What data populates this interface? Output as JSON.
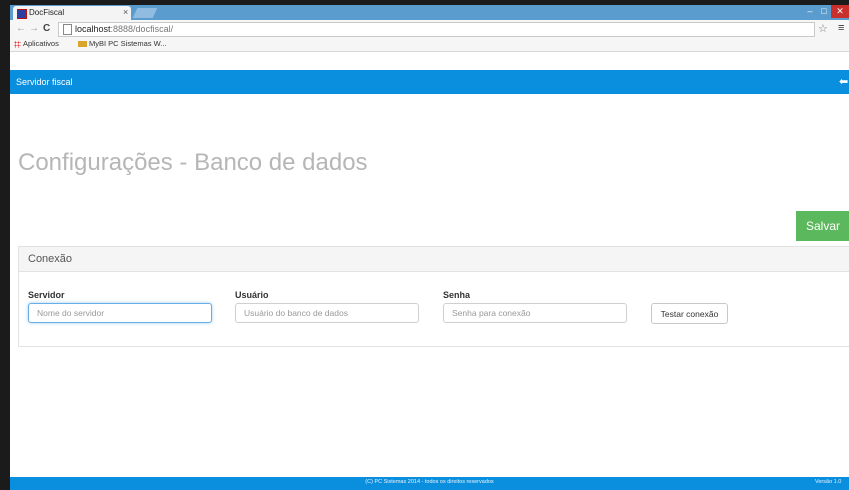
{
  "browser": {
    "tab_title": "DocFiscal",
    "tab_close": "×",
    "window_min": "–",
    "window_max": "□",
    "window_close": "✕",
    "back": "←",
    "forward": "→",
    "reload": "C",
    "url_host": "localhost",
    "url_rest": ":8888/docfiscal/",
    "bookmark_star": "☆",
    "menu": "≡",
    "bookmarks": [
      {
        "label": "Aplicativos",
        "icon": "apps-grid-icon"
      },
      {
        "label": "MyBI PC Sistemas W...",
        "icon": "folder-icon"
      }
    ]
  },
  "navbar": {
    "brand": "Servidor fiscal",
    "signout_icon": "sign-out-arrow-icon",
    "signout_glyph": "⬅"
  },
  "page": {
    "title": "Configurações - Banco de dados",
    "save_label": "Salvar"
  },
  "panel": {
    "title": "Conexão",
    "fields": {
      "servidor": {
        "label": "Servidor",
        "placeholder": "Nome do servidor",
        "value": ""
      },
      "usuario": {
        "label": "Usuário",
        "placeholder": "Usuário do banco de dados",
        "value": ""
      },
      "senha": {
        "label": "Senha",
        "placeholder": "Senha para conexão",
        "value": ""
      }
    },
    "test_label": "Testar conexão"
  },
  "footer": {
    "copyright": "(C) PC Sistemas 2014 - todos os direitos reservados",
    "version": "Versão 1.0"
  },
  "colors": {
    "navbar": "#0a8ede",
    "save_button": "#5cb85c",
    "tabstrip": "#5b9ccf",
    "focus": "#66afe9"
  }
}
